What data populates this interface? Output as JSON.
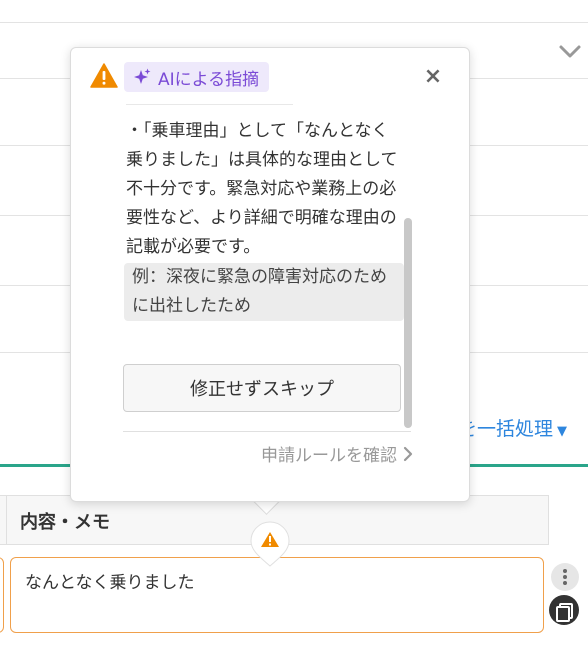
{
  "background": {
    "bulk_action_label": "を一括処理",
    "bulk_action_caret": "▼"
  },
  "table": {
    "column_header": "内容・メモ",
    "memo_value": "なんとなく乗りました"
  },
  "popover": {
    "badge_label": "AIによる指摘",
    "close_label": "×",
    "issue_text": "・「乗車理由」として「なんとなく乗りました」は具体的な理由として不十分です。緊急対応や業務上の必要性など、より詳細で明確な理由の記載が必要です。",
    "example_text": "例：深夜に緊急の障害対応のために出社したため",
    "skip_button_label": "修正せずスキップ",
    "rules_link_label": "申請ルールを確認",
    "rules_link_chevron": "›"
  },
  "icons": {
    "warning": "warning-icon",
    "sparkle": "sparkle-icon",
    "chevron_down": "chevron-down-icon",
    "more": "more-vertical-icon",
    "copy": "copy-icon"
  },
  "colors": {
    "accent_purple": "#7b4bd6",
    "badge_bg": "#eee9fb",
    "warning_orange": "#f08a00",
    "link_blue": "#2e86de",
    "green_bar": "#2aa58a",
    "input_border_warning": "#f0a04b"
  }
}
